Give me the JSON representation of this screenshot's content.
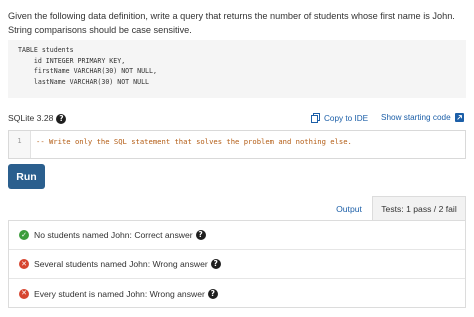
{
  "question": "Given the following data definition, write a query that returns the number of students whose first name is John. String comparisons should be case sensitive.",
  "schema_code": "TABLE students\n    id INTEGER PRIMARY KEY,\n    firstName VARCHAR(30) NOT NULL,\n    lastName VARCHAR(30) NOT NULL",
  "engine": {
    "label": "SQLite 3.28"
  },
  "links": {
    "copy_to_ide": "Copy to IDE",
    "show_starting_code": "Show starting code"
  },
  "editor": {
    "line_number": "1",
    "code": "-- Write only the SQL statement that solves the problem and nothing else."
  },
  "run_label": "Run",
  "tabs": {
    "output": "Output",
    "tests": "Tests: 1 pass / 2 fail"
  },
  "tests": [
    {
      "text": "No students named John: Correct answer",
      "status": "pass"
    },
    {
      "text": "Several students named John: Wrong answer",
      "status": "fail"
    },
    {
      "text": "Every student is named John: Wrong answer",
      "status": "fail"
    }
  ],
  "colors": {
    "accent": "#1c5fa8",
    "run_button": "#2b5f8e",
    "pass": "#3c9c3c",
    "fail": "#d6452f",
    "comment": "#b35c14"
  },
  "icons": {
    "help": "question-circle-icon",
    "copy": "copy-icon",
    "external": "external-link-icon",
    "pass": "check-circle-icon",
    "fail": "x-circle-icon"
  }
}
